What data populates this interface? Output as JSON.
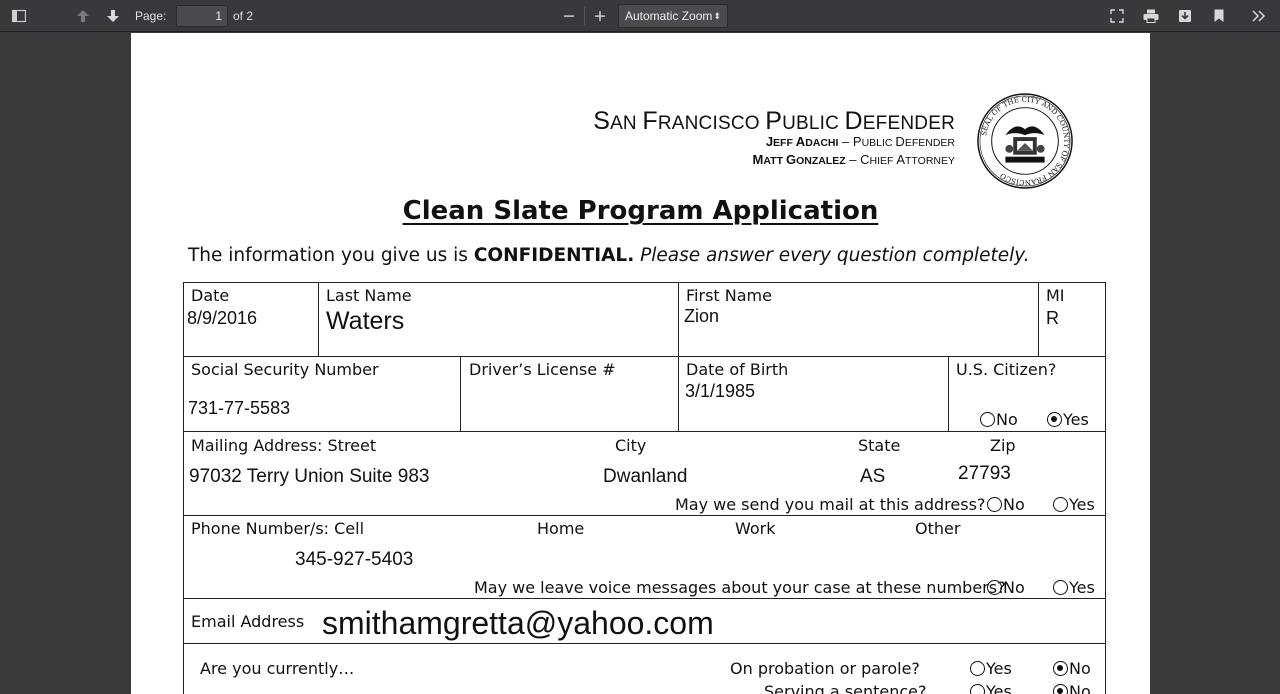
{
  "toolbar": {
    "page_label": "Page:",
    "page_value": "1",
    "page_of": "of 2",
    "zoom_value": "Automatic Zoom"
  },
  "letterhead": {
    "org_first": "S",
    "org_first_rest": "AN ",
    "org_second": "F",
    "org_second_rest": "RANCISCO ",
    "org_third": "P",
    "org_third_rest": "UBLIC ",
    "org_fourth": "D",
    "org_fourth_rest": "EFENDER",
    "line1_name_j": "J",
    "line1_name_rest": "EFF ",
    "line1_name_a": "A",
    "line1_name_a_rest": "DACHI",
    "line1_dash": " – ",
    "line1_role_p": "P",
    "line1_role_p_rest": "UBLIC ",
    "line1_role_d": "D",
    "line1_role_d_rest": "EFENDER",
    "line2_name_m": "M",
    "line2_name_rest": "ATT ",
    "line2_name_g": "G",
    "line2_name_g_rest": "ONZALEZ",
    "line2_dash": " – ",
    "line2_role_c": "C",
    "line2_role_c_rest": "HIEF ",
    "line2_role_a": "A",
    "line2_role_a_rest": "TTORNEY",
    "seal_text": "SEAL OF THE CITY AND COUNTY OF SAN FRANCISCO"
  },
  "title": "Clean Slate Program Application",
  "intro": {
    "plain": "The information you give us is ",
    "bold": "CONFIDENTIAL.",
    "italic": " Please answer every question completely."
  },
  "form": {
    "date_label": "Date",
    "date_value": "8/9/2016",
    "last_name_label": "Last Name",
    "last_name_value": "Waters",
    "first_name_label": "First Name",
    "first_name_value": "Zion",
    "mi_label": "MI",
    "mi_value": "R",
    "ssn_label": "Social Security Number",
    "ssn_value": "731-77-5583",
    "dl_label": "Driver’s License #",
    "dob_label": "Date of Birth",
    "dob_value": "3/1/1985",
    "citizen_label": "U.S. Citizen?",
    "citizen_no": "No",
    "citizen_yes": "Yes",
    "citizen_selected": "Yes",
    "mail_label": "Mailing Address:  Street",
    "city_label": "City",
    "state_label": "State",
    "zip_label": "Zip",
    "street_value": "97032 Terry Union Suite 983",
    "city_value": "Dwanland",
    "state_value": "AS",
    "zip_value": "27793",
    "mail_question": "May we send you mail at this address?",
    "mail_no": "No",
    "mail_yes": "Yes",
    "phone_label": "Phone Number/s:  Cell",
    "home_label": "Home",
    "work_label": "Work",
    "other_label": "Other",
    "cell_value": "345-927-5403",
    "voice_question": "May we leave voice messages about your case at these numbers?",
    "voice_no": "No",
    "voice_yes": "Yes",
    "email_label": "Email Address",
    "email_value": "smithamgretta@yahoo.com",
    "currently_label": "Are you currently…",
    "probation_question": "On probation or parole?",
    "probation_yes": "Yes",
    "probation_no": "No",
    "probation_selected": "No",
    "sentence_question": "Serving a sentence?",
    "sentence_yes": "Yes",
    "sentence_no": "No",
    "sentence_selected": "No"
  }
}
